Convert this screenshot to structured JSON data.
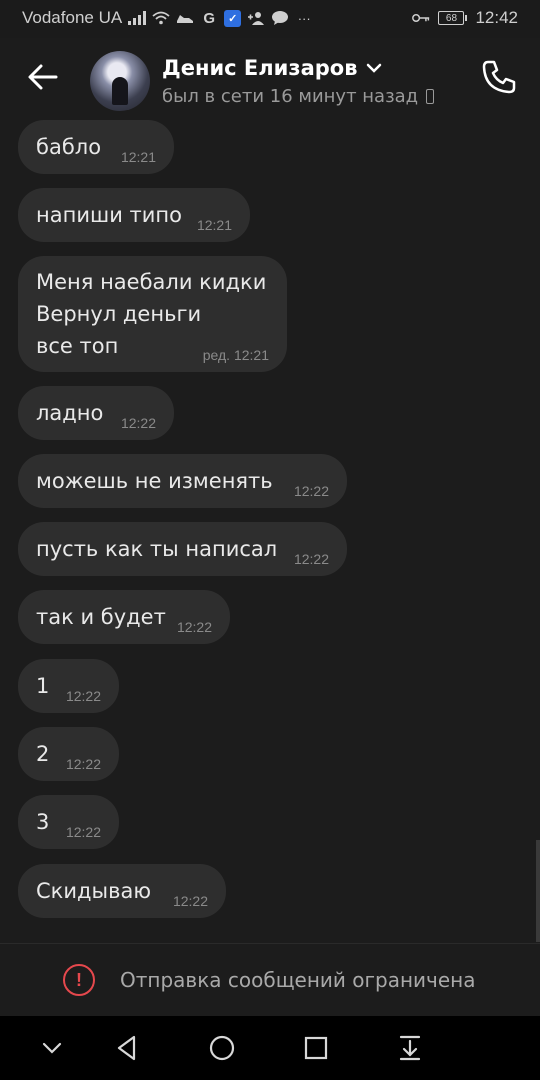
{
  "status_bar": {
    "carrier": "Vodafone UA",
    "battery_level": "68",
    "time": "12:42",
    "icons": [
      "signal-icon",
      "wifi-icon",
      "sneaker-icon",
      "g-icon",
      "vpn-icon",
      "contact-add-icon",
      "chat-bubble-icon",
      "more-dots-icon",
      "key-icon",
      "battery-icon"
    ]
  },
  "header": {
    "contact_name": "Денис Елизаров",
    "last_seen": "был в сети 16 минут назад"
  },
  "messages": [
    {
      "text": "бабло",
      "time": "12:21"
    },
    {
      "text": "напиши типо",
      "time": "12:21"
    },
    {
      "text": "Меня наебали кидки\nВернул деньги\nвсе топ",
      "time": "ред. 12:21"
    },
    {
      "text": "ладно",
      "time": "12:22"
    },
    {
      "text": "можешь не изменять",
      "time": "12:22"
    },
    {
      "text": "пусть как ты написал",
      "time": "12:22"
    },
    {
      "text": "так и будет",
      "time": "12:22"
    },
    {
      "text": "1",
      "time": "12:22"
    },
    {
      "text": "2",
      "time": "12:22"
    },
    {
      "text": "3",
      "time": "12:22"
    },
    {
      "text": "Скидываю",
      "time": "12:22"
    }
  ],
  "restriction": {
    "text": "Отправка сообщений ограничена"
  },
  "colors": {
    "background": "#1c1c1c",
    "bubble": "#2e2e2e",
    "warning": "#e5484d"
  }
}
